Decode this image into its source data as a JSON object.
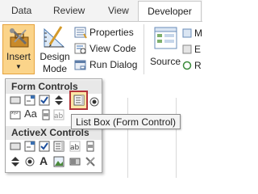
{
  "ribbon": {
    "tabs": [
      {
        "label": "Data"
      },
      {
        "label": "Review"
      },
      {
        "label": "View"
      },
      {
        "label": "Developer"
      }
    ],
    "insert_label": "Insert",
    "design_mode_line1": "Design",
    "design_mode_line2": "Mode",
    "properties_label": "Properties",
    "view_code_label": "View Code",
    "run_dialog_label": "Run Dialog",
    "source_label": "Source",
    "truncated_labels": [
      "M",
      "E",
      "R"
    ]
  },
  "dropdown": {
    "form_controls_header": "Form Controls",
    "activex_controls_header": "ActiveX Controls",
    "tooltip": "List Box (Form Control)"
  },
  "colors": {
    "insert_highlight": "#fbd48a",
    "selected_control_border": "#b3343a"
  }
}
